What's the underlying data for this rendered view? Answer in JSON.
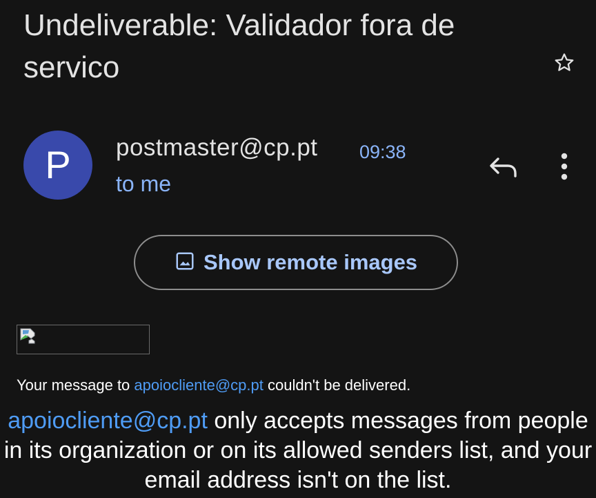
{
  "subject": "Undeliverable: Validador fora de servico",
  "sender": {
    "avatar_letter": "P",
    "avatar_color": "#3949ab",
    "address": "postmaster@cp.pt",
    "time": "09:38",
    "recipient": "to me"
  },
  "icons": {
    "star": "star-outline-icon",
    "reply": "reply-icon",
    "more": "more-vert-icon",
    "image": "image-icon",
    "broken_image": "broken-image-icon"
  },
  "remote_images": {
    "label": "Show remote images"
  },
  "body": {
    "line1_prefix": "Your message to ",
    "line1_link": "apoiocliente@cp.pt",
    "line1_suffix": " couldn't be delivered.",
    "para_link": "apoiocliente@cp.pt",
    "para_text": " only accepts messages from people in its organization or on its allowed senders list, and your email address isn't on the list."
  },
  "colors": {
    "background": "#141414",
    "accent_blue": "#8ab4f8",
    "link_blue": "#4f9cf5"
  }
}
